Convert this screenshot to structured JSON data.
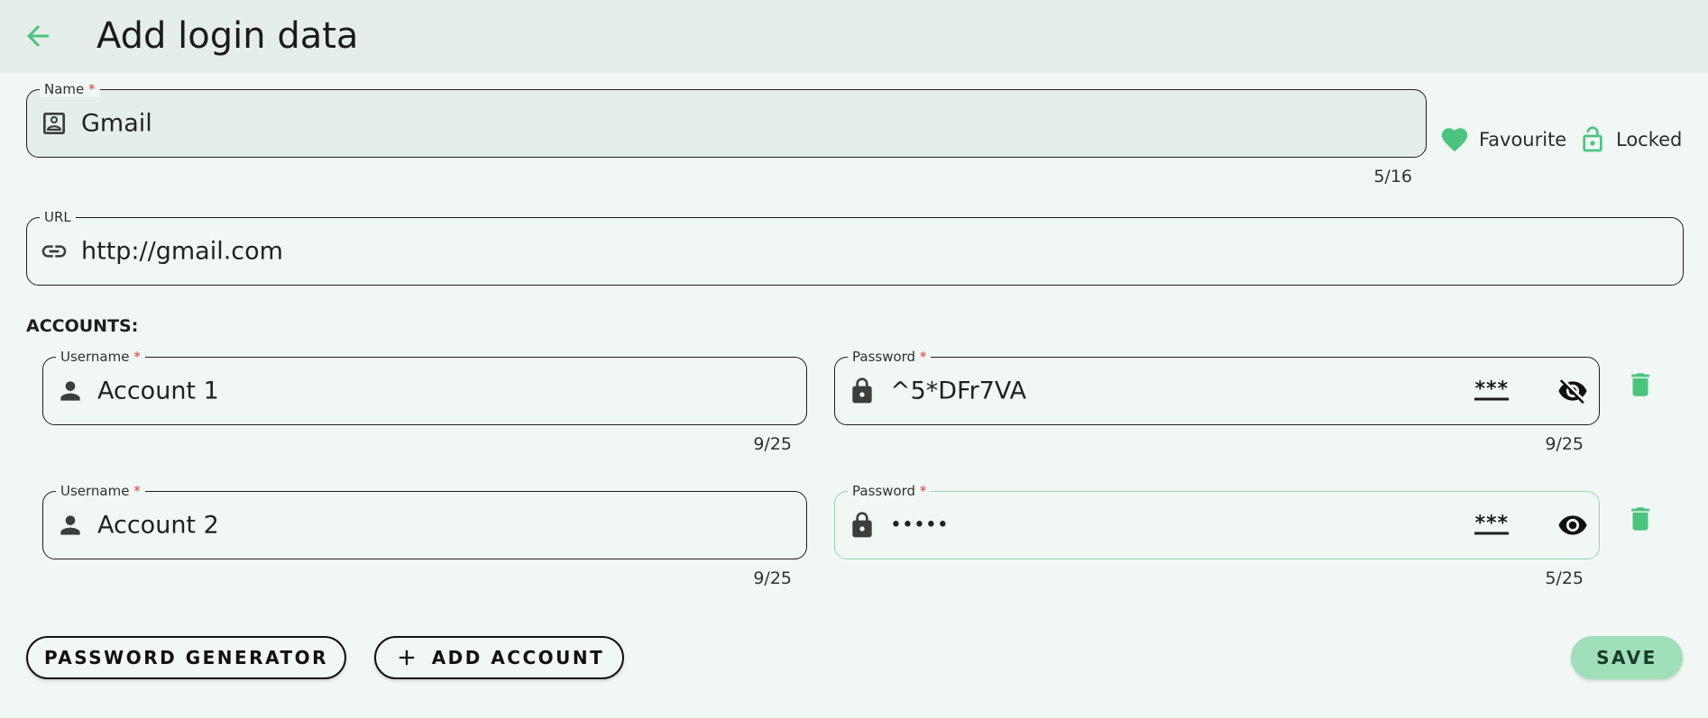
{
  "header": {
    "title": "Add login data",
    "back_icon": "arrow-left-icon"
  },
  "colors": {
    "accent": "#4cc47f",
    "header_bg": "#e5eee9",
    "page_bg": "#f1f7f4",
    "required": "#e53935"
  },
  "name_field": {
    "label": "Name",
    "required_mark": "*",
    "value": "Gmail",
    "counter": "5/16",
    "icon": "contact-card-icon"
  },
  "favourite": {
    "label": "Favourite",
    "icon": "heart-icon"
  },
  "locked": {
    "label": "Locked",
    "icon": "lock-open-icon"
  },
  "url_field": {
    "label": "URL",
    "value": "http://gmail.com",
    "icon": "link-icon"
  },
  "accounts": {
    "title": "ACCOUNTS:",
    "items": [
      {
        "username_label": "Username",
        "username_required": "*",
        "username": "Account 1",
        "username_counter": "9/25",
        "password_label": "Password",
        "password_required": "*",
        "password": "^5*DFr7VA",
        "password_counter": "9/25",
        "generate_label": "***",
        "visibility_icon": "eye-off-icon",
        "delete_icon": "trash-icon"
      },
      {
        "username_label": "Username",
        "username_required": "*",
        "username": "Account 2",
        "username_counter": "9/25",
        "password_label": "Password",
        "password_required": "*",
        "password": "•••••",
        "password_counter": "5/25",
        "generate_label": "***",
        "visibility_icon": "eye-icon",
        "delete_icon": "trash-icon"
      }
    ]
  },
  "buttons": {
    "password_generator": "PASSWORD GENERATOR",
    "add_account": "ADD ACCOUNT",
    "add_icon": "plus-icon",
    "save": "SAVE"
  }
}
